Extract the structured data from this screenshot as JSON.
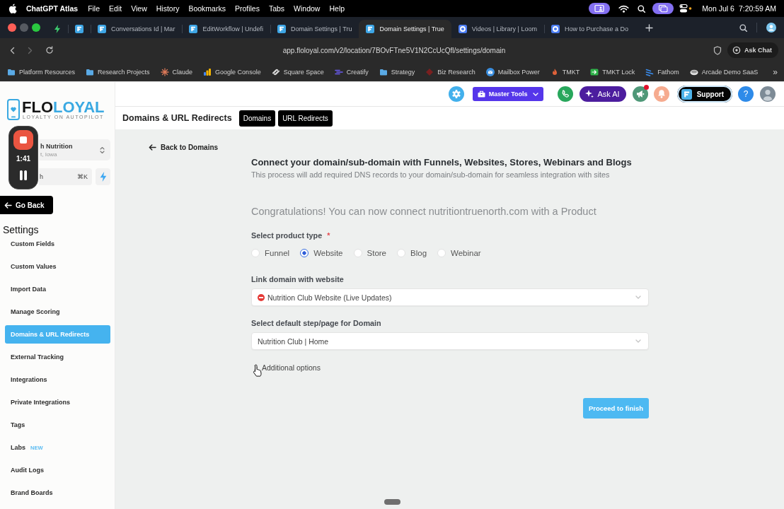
{
  "menu_bar": {
    "app_name": "ChatGPT Atlas",
    "menus": [
      "File",
      "Edit",
      "View",
      "History",
      "Bookmarks",
      "Profiles",
      "Tabs",
      "Window",
      "Help"
    ],
    "date": "Mon Jul 6",
    "time": "7:20:59 AM"
  },
  "browser": {
    "tabs": [
      {
        "kind": "bolt",
        "selected": false
      },
      {
        "kind": "app",
        "selected": false
      },
      {
        "kind": "app",
        "title": "Conversations Id | Mar",
        "selected": false
      },
      {
        "kind": "app",
        "title": "EditWorkflow | Undefi",
        "selected": false
      },
      {
        "kind": "app",
        "title": "Domain Settings | Tru",
        "selected": false
      },
      {
        "kind": "app",
        "title": "Domain Settings | True",
        "selected": true
      },
      {
        "kind": "video",
        "title": "Videos | Library | Loom",
        "selected": false
      },
      {
        "kind": "video",
        "title": "How to Purchase a Do",
        "selected": false
      }
    ],
    "url": "app.floloyal.com/v2/location/7BOvFTne5V1N2CcUcQfl/settings/domain",
    "ask_chat": "Ask Chat",
    "bookmarks": [
      {
        "label": "Platform Resources",
        "kind": "folder"
      },
      {
        "label": "Research Projects",
        "kind": "folder"
      },
      {
        "label": "Claude",
        "kind": "starburst"
      },
      {
        "label": "Google Console",
        "kind": "bars"
      },
      {
        "label": "Square Space",
        "kind": "knot"
      },
      {
        "label": "Creatify",
        "kind": "stripes"
      },
      {
        "label": "Strategy",
        "kind": "folder"
      },
      {
        "label": "Biz Research",
        "kind": "diamond"
      },
      {
        "label": "Mailbox Power",
        "kind": "envelope"
      },
      {
        "label": "TMKT",
        "kind": "flame"
      },
      {
        "label": "TMKT Lock",
        "kind": "arrow"
      },
      {
        "label": "Fathom",
        "kind": "slashes"
      },
      {
        "label": "Arcade Demo SaaS",
        "kind": "disc"
      }
    ],
    "more": "»"
  },
  "sidebar": {
    "logo": {
      "wordmark": [
        "FLO",
        "LOYAL"
      ],
      "tagline": "LOYALTY ON AUTOPILOT"
    },
    "location": {
      "name": "h Nutrition",
      "address": "t, Iowa"
    },
    "search": {
      "placeholder": "h",
      "shortcut": "⌘K"
    },
    "go_back": "Go Back",
    "title": "Settings",
    "items": [
      {
        "label": "Custom Fields",
        "selected": false
      },
      {
        "label": "Custom Values",
        "selected": false
      },
      {
        "label": "Import Data",
        "selected": false
      },
      {
        "label": "Manage Scoring",
        "selected": false
      },
      {
        "label": "Domains & URL Redirects",
        "selected": true
      },
      {
        "label": "External Tracking",
        "selected": false
      },
      {
        "label": "Integrations",
        "selected": false
      },
      {
        "label": "Private Integrations",
        "selected": false
      },
      {
        "label": "Tags",
        "selected": false
      },
      {
        "label": "Labs",
        "selected": false,
        "badge": "NEW"
      },
      {
        "label": "Audit Logs",
        "selected": false
      },
      {
        "label": "Brand Boards",
        "selected": false
      }
    ]
  },
  "recorder": {
    "time": "1:41"
  },
  "top_bar": {
    "master_tools": "Master Tools",
    "ask_ai": "Ask AI",
    "notification": true,
    "support": "Support",
    "help": "?"
  },
  "page": {
    "title": "Domains & URL Redirects",
    "tabs": [
      "Domains",
      "URL Redirects"
    ]
  },
  "form": {
    "back": "Back to Domains",
    "heading": "Connect your domain/sub-domain with Funnels, Websites, Stores, Webinars and Blogs",
    "subheading": "This process will add required DNS records to your domain/sub-domain for seamless integration with sites",
    "notice": "Congratulations! You can now connect nutritiontruenorth.com with a Product",
    "product_type": {
      "label": "Select product type",
      "required_mark": "*",
      "options": [
        {
          "label": "Funnel",
          "selected": false
        },
        {
          "label": "Website",
          "selected": true
        },
        {
          "label": "Store",
          "selected": false
        },
        {
          "label": "Blog",
          "selected": false
        },
        {
          "label": "Webinar",
          "selected": false
        }
      ]
    },
    "website": {
      "label": "Link domain with website",
      "value": "Nutrition Club Website (Live Updates)"
    },
    "default_page": {
      "label": "Select default step/page for Domain",
      "value": "Nutrition Club | Home"
    },
    "additional_options": {
      "label": "Additional options",
      "expanded": false
    },
    "submit": "Proceed to finish"
  }
}
